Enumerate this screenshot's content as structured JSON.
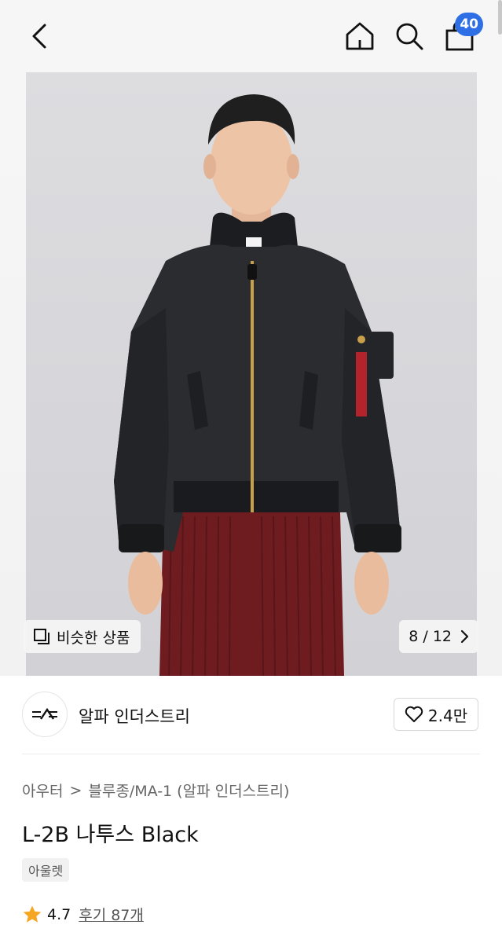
{
  "header": {
    "back_icon": "chevron-left-icon",
    "home_icon": "home-icon",
    "search_icon": "search-icon",
    "cart_icon": "shopping-bag-icon",
    "cart_count": "40",
    "badge_color": "#2f6fe6"
  },
  "gallery": {
    "similar_label": "비슷한 상품",
    "similar_icon": "similar-items-icon",
    "counter": "8 / 12",
    "next_icon": "chevron-right-icon"
  },
  "brand": {
    "name": "알파 인더스트리",
    "likes": "2.4만",
    "like_icon": "heart-icon"
  },
  "breadcrumb": {
    "category": "아우터",
    "separator": ">",
    "subcategory": "블루종/MA-1 (알파 인더스트리)"
  },
  "product": {
    "title": "L-2B 나투스 Black",
    "tag": "아울렛"
  },
  "rating": {
    "value": "4.7",
    "reviews_label": "후기 87개",
    "star_color": "#f5a623"
  }
}
